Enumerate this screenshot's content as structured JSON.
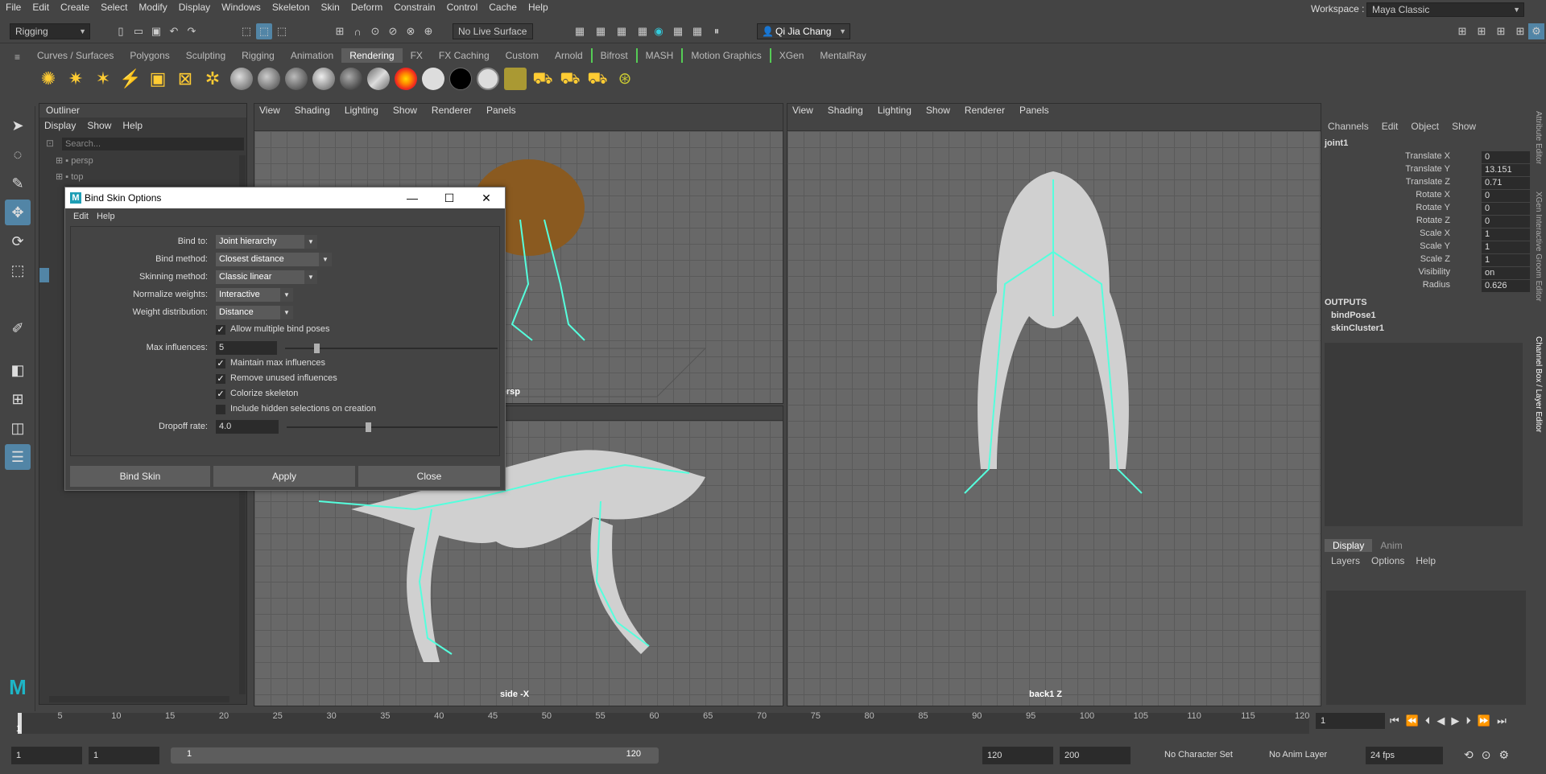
{
  "menubar": [
    "File",
    "Edit",
    "Create",
    "Select",
    "Modify",
    "Display",
    "Windows",
    "Skeleton",
    "Skin",
    "Deform",
    "Constrain",
    "Control",
    "Cache",
    "Help"
  ],
  "workspace": {
    "label": "Workspace :",
    "value": "Maya Classic"
  },
  "status": {
    "mode": "Rigging",
    "live_surface": "No Live Surface",
    "user": "Qi Jia Chang"
  },
  "shelf_tabs": [
    "Curves / Surfaces",
    "Polygons",
    "Sculpting",
    "Rigging",
    "Animation",
    "Rendering",
    "FX",
    "FX Caching",
    "Custom",
    "Arnold",
    "Bifrost",
    "MASH",
    "Motion Graphics",
    "XGen",
    "MentalRay"
  ],
  "shelf_active": "Rendering",
  "outliner": {
    "title": "Outliner",
    "menu": [
      "Display",
      "Show",
      "Help"
    ],
    "search_placeholder": "Search...",
    "items": [
      "persp",
      "top"
    ]
  },
  "viewport_menu": [
    "View",
    "Shading",
    "Lighting",
    "Show",
    "Renderer",
    "Panels"
  ],
  "viewports": {
    "persp_label": "persp",
    "side_label": "side -X",
    "back_label": "back1 Z"
  },
  "channelbox": {
    "tabs": [
      "Channels",
      "Edit",
      "Object",
      "Show"
    ],
    "node": "joint1",
    "attrs": [
      {
        "name": "Translate X",
        "value": "0"
      },
      {
        "name": "Translate Y",
        "value": "13.151"
      },
      {
        "name": "Translate Z",
        "value": "0.71"
      },
      {
        "name": "Rotate X",
        "value": "0"
      },
      {
        "name": "Rotate Y",
        "value": "0"
      },
      {
        "name": "Rotate Z",
        "value": "0"
      },
      {
        "name": "Scale X",
        "value": "1"
      },
      {
        "name": "Scale Y",
        "value": "1"
      },
      {
        "name": "Scale Z",
        "value": "1"
      },
      {
        "name": "Visibility",
        "value": "on"
      },
      {
        "name": "Radius",
        "value": "0.626"
      }
    ],
    "outputs_label": "OUTPUTS",
    "outputs": [
      "bindPose1",
      "skinCluster1"
    ]
  },
  "layer_editor": {
    "tabs": [
      "Display",
      "Anim"
    ],
    "menu": [
      "Layers",
      "Options",
      "Help"
    ]
  },
  "side_tabs": [
    "Attribute Editor",
    "XGen Interactive Groom Editor",
    "Channel Box / Layer Editor"
  ],
  "dialog": {
    "title": "Bind Skin Options",
    "menu": [
      "Edit",
      "Help"
    ],
    "bind_to_label": "Bind to:",
    "bind_to": "Joint hierarchy",
    "bind_method_label": "Bind method:",
    "bind_method": "Closest distance",
    "skinning_label": "Skinning method:",
    "skinning": "Classic linear",
    "normalize_label": "Normalize weights:",
    "normalize": "Interactive",
    "weight_dist_label": "Weight distribution:",
    "weight_dist": "Distance",
    "allow_multi": "Allow multiple bind poses",
    "max_inf_label": "Max influences:",
    "max_inf": "5",
    "maintain_max": "Maintain max influences",
    "remove_unused": "Remove unused influences",
    "colorize": "Colorize skeleton",
    "include_hidden": "Include hidden selections on creation",
    "dropoff_label": "Dropoff rate:",
    "dropoff": "4.0",
    "btn_bind": "Bind Skin",
    "btn_apply": "Apply",
    "btn_close": "Close"
  },
  "timeline": {
    "ticks": [
      "5",
      "10",
      "15",
      "20",
      "25",
      "30",
      "35",
      "40",
      "45",
      "50",
      "55",
      "60",
      "65",
      "70",
      "75",
      "80",
      "85",
      "90",
      "95",
      "100",
      "105",
      "110",
      "115",
      "120"
    ],
    "current": "1",
    "current_field": "1"
  },
  "range": {
    "start": "1",
    "start2": "1",
    "range_start": "1",
    "range_end": "120",
    "end": "120",
    "end2": "200",
    "character": "No Character Set",
    "anim_layer": "No Anim Layer",
    "fps": "24 fps"
  }
}
